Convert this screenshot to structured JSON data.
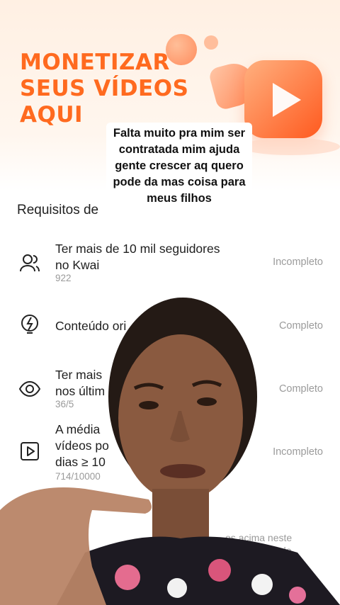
{
  "banner": {
    "title": "MONETIZAR\nSEUS VÍDEOS\nAQUI"
  },
  "caption": {
    "text": "Falta muito pra mim ser contratada mim ajuda gente crescer aq quero pode da mas coisa para meus filhos"
  },
  "requirements": {
    "section_title": "Requisitos de",
    "items": [
      {
        "icon": "followers-icon",
        "label": "Ter mais de 10 mil seguidores\nno Kwai",
        "value": "922",
        "status": "Incompleto"
      },
      {
        "icon": "lightbulb-icon",
        "label": "Conteúdo ori",
        "value": "",
        "status": "Completo"
      },
      {
        "icon": "eye-icon",
        "label": "Ter mais\nnos últim",
        "value": "36/5",
        "status": "Completo"
      },
      {
        "icon": "video-play-icon",
        "label": "A média\nvídeos po\ndias ≥ 10",
        "value": "714/10000",
        "status": "Incompleto"
      }
    ]
  },
  "footer": {
    "text": "os acima neste\npulares fora do"
  }
}
